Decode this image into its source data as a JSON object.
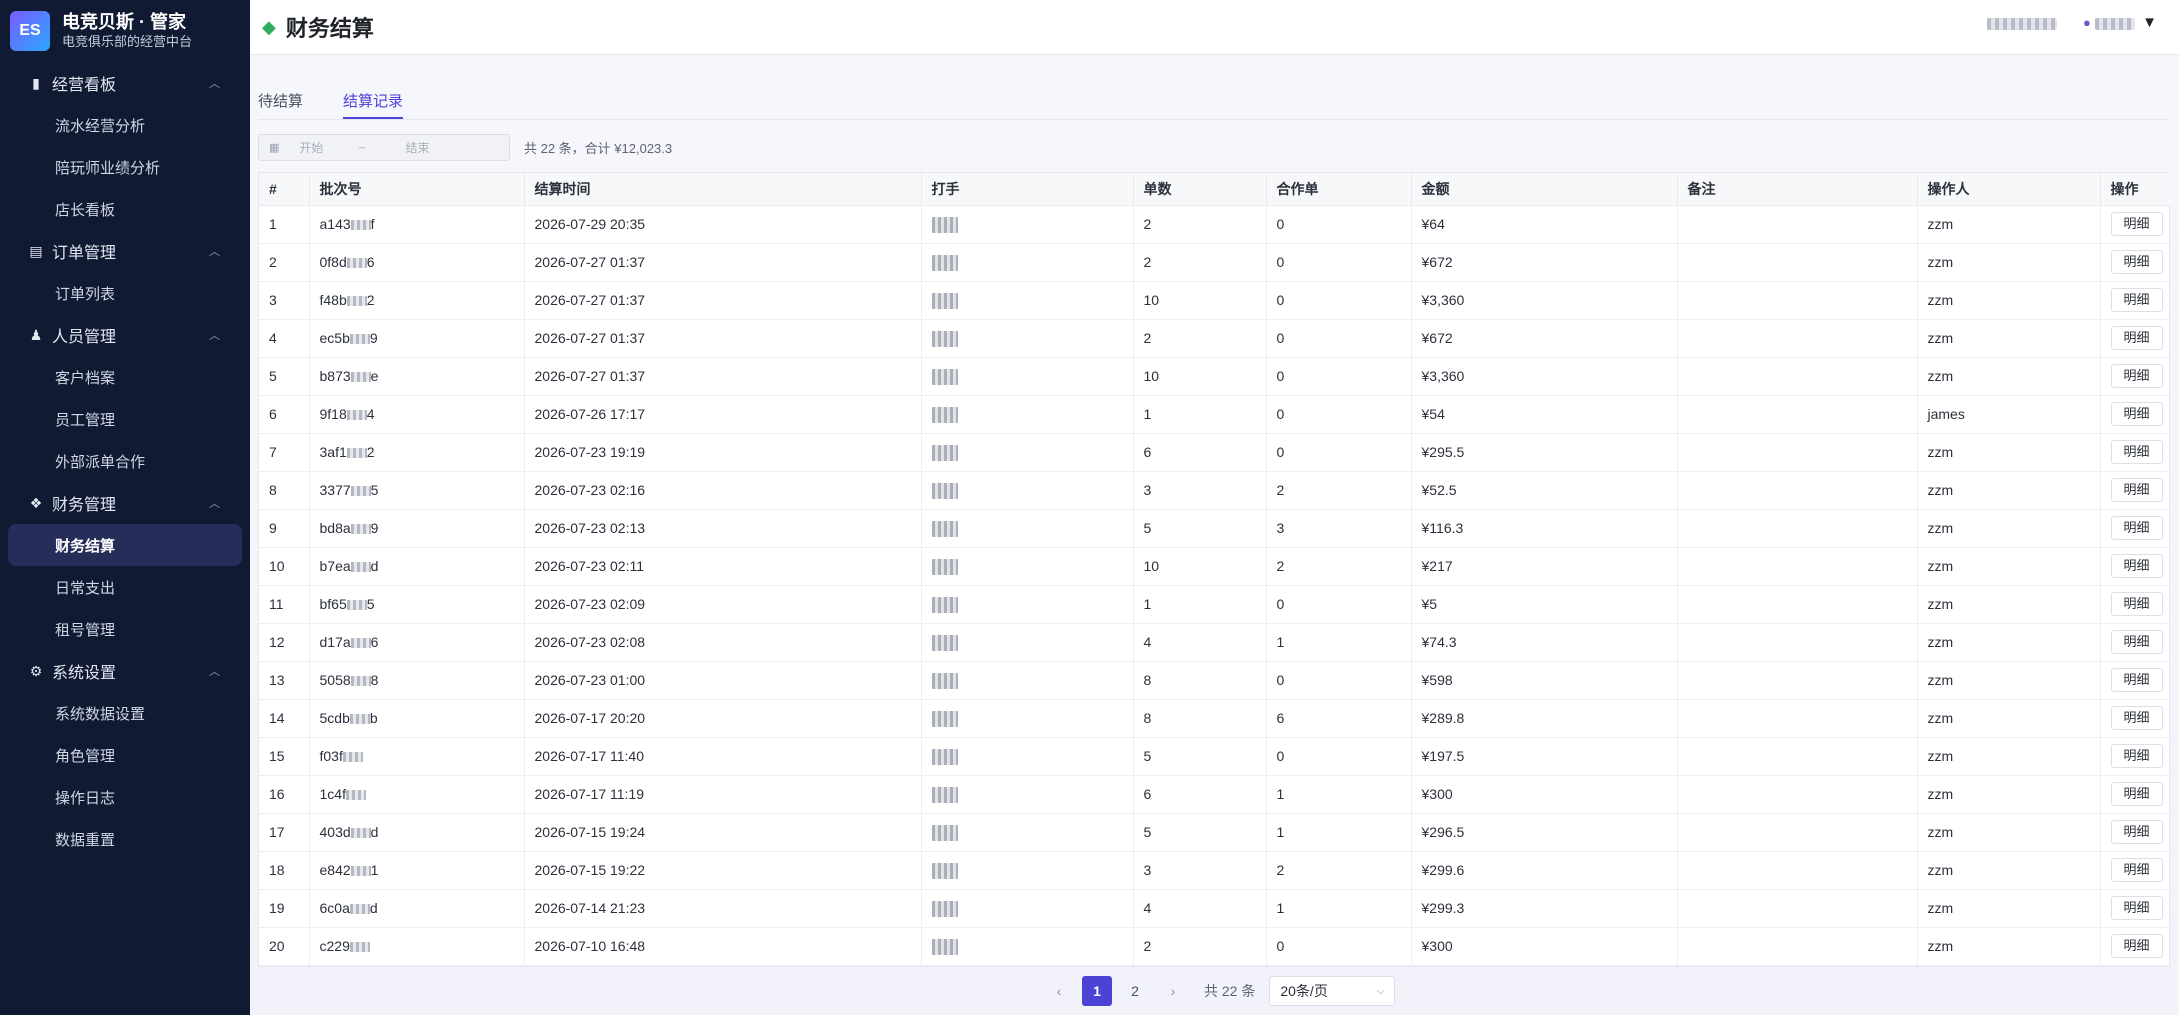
{
  "app": {
    "name": "电竞贝斯 · 管家",
    "subtitle": "电竞俱乐部的经营中台",
    "logo_text": "ES"
  },
  "sidebar": {
    "groups": [
      {
        "icon": "chart-icon",
        "icon_glyph": "▮",
        "label": "经营看板",
        "items": [
          "流水经营分析",
          "陪玩师业绩分析",
          "店长看板"
        ]
      },
      {
        "icon": "clipboard-icon",
        "icon_glyph": "▤",
        "label": "订单管理",
        "items": [
          "订单列表"
        ]
      },
      {
        "icon": "people-icon",
        "icon_glyph": "♟",
        "label": "人员管理",
        "items": [
          "客户档案",
          "员工管理",
          "外部派单合作"
        ]
      },
      {
        "icon": "money-bag-icon",
        "icon_glyph": "❖",
        "label": "财务管理",
        "items": [
          "财务结算",
          "日常支出",
          "租号管理"
        ]
      },
      {
        "icon": "gear-icon",
        "icon_glyph": "⚙",
        "label": "系统设置",
        "items": [
          "系统数据设置",
          "角色管理",
          "操作日志",
          "数据重置"
        ]
      }
    ],
    "active_item": "财务结算"
  },
  "header": {
    "title": "财务结算",
    "title_icon": "cash-icon"
  },
  "tabs": [
    "待结算",
    "结算记录"
  ],
  "active_tab": "结算记录",
  "filter": {
    "start_placeholder": "开始",
    "separator": "~",
    "end_placeholder": "结束",
    "summary": "共 22 条，合计 ¥12,023.3"
  },
  "table": {
    "columns": [
      "#",
      "批次号",
      "结算时间",
      "打手",
      "单数",
      "合作单",
      "金额",
      "备注",
      "操作人",
      "操作"
    ],
    "action_label": "明细",
    "rows": [
      {
        "idx": "1",
        "batch": "a143",
        "batch_tail": "f",
        "time": "2026-07-29 20:35",
        "count": "2",
        "coop": "0",
        "amount": "¥64",
        "note": "",
        "operator": "zzm"
      },
      {
        "idx": "2",
        "batch": "0f8d",
        "batch_tail": "6",
        "time": "2026-07-27 01:37",
        "count": "2",
        "coop": "0",
        "amount": "¥672",
        "note": "",
        "operator": "zzm"
      },
      {
        "idx": "3",
        "batch": "f48b",
        "batch_tail": "2",
        "time": "2026-07-27 01:37",
        "count": "10",
        "coop": "0",
        "amount": "¥3,360",
        "note": "",
        "operator": "zzm"
      },
      {
        "idx": "4",
        "batch": "ec5b",
        "batch_tail": "9",
        "time": "2026-07-27 01:37",
        "count": "2",
        "coop": "0",
        "amount": "¥672",
        "note": "",
        "operator": "zzm"
      },
      {
        "idx": "5",
        "batch": "b873",
        "batch_tail": "e",
        "time": "2026-07-27 01:37",
        "count": "10",
        "coop": "0",
        "amount": "¥3,360",
        "note": "",
        "operator": "zzm"
      },
      {
        "idx": "6",
        "batch": "9f18",
        "batch_tail": "4",
        "time": "2026-07-26 17:17",
        "count": "1",
        "coop": "0",
        "amount": "¥54",
        "note": "",
        "operator": "james"
      },
      {
        "idx": "7",
        "batch": "3af1",
        "batch_tail": "2",
        "time": "2026-07-23 19:19",
        "count": "6",
        "coop": "0",
        "amount": "¥295.5",
        "note": "",
        "operator": "zzm"
      },
      {
        "idx": "8",
        "batch": "3377",
        "batch_tail": "5",
        "time": "2026-07-23 02:16",
        "count": "3",
        "coop": "2",
        "amount": "¥52.5",
        "note": "",
        "operator": "zzm"
      },
      {
        "idx": "9",
        "batch": "bd8a",
        "batch_tail": "9",
        "time": "2026-07-23 02:13",
        "count": "5",
        "coop": "3",
        "amount": "¥116.3",
        "note": "",
        "operator": "zzm"
      },
      {
        "idx": "10",
        "batch": "b7ea",
        "batch_tail": "d",
        "time": "2026-07-23 02:11",
        "count": "10",
        "coop": "2",
        "amount": "¥217",
        "note": "",
        "operator": "zzm"
      },
      {
        "idx": "11",
        "batch": "bf65",
        "batch_tail": "5",
        "time": "2026-07-23 02:09",
        "count": "1",
        "coop": "0",
        "amount": "¥5",
        "note": "",
        "operator": "zzm"
      },
      {
        "idx": "12",
        "batch": "d17a",
        "batch_tail": "6",
        "time": "2026-07-23 02:08",
        "count": "4",
        "coop": "1",
        "amount": "¥74.3",
        "note": "",
        "operator": "zzm"
      },
      {
        "idx": "13",
        "batch": "5058",
        "batch_tail": "8",
        "time": "2026-07-23 01:00",
        "count": "8",
        "coop": "0",
        "amount": "¥598",
        "note": "",
        "operator": "zzm"
      },
      {
        "idx": "14",
        "batch": "5cdb",
        "batch_tail": "b",
        "time": "2026-07-17 20:20",
        "count": "8",
        "coop": "6",
        "amount": "¥289.8",
        "note": "",
        "operator": "zzm"
      },
      {
        "idx": "15",
        "batch": "f03f",
        "batch_tail": "",
        "time": "2026-07-17 11:40",
        "count": "5",
        "coop": "0",
        "amount": "¥197.5",
        "note": "",
        "operator": "zzm"
      },
      {
        "idx": "16",
        "batch": "1c4f",
        "batch_tail": "",
        "time": "2026-07-17 11:19",
        "count": "6",
        "coop": "1",
        "amount": "¥300",
        "note": "",
        "operator": "zzm"
      },
      {
        "idx": "17",
        "batch": "403d",
        "batch_tail": "d",
        "time": "2026-07-15 19:24",
        "count": "5",
        "coop": "1",
        "amount": "¥296.5",
        "note": "",
        "operator": "zzm"
      },
      {
        "idx": "18",
        "batch": "e842",
        "batch_tail": "1",
        "time": "2026-07-15 19:22",
        "count": "3",
        "coop": "2",
        "amount": "¥299.6",
        "note": "",
        "operator": "zzm"
      },
      {
        "idx": "19",
        "batch": "6c0a",
        "batch_tail": "d",
        "time": "2026-07-14 21:23",
        "count": "4",
        "coop": "1",
        "amount": "¥299.3",
        "note": "",
        "operator": "zzm"
      },
      {
        "idx": "20",
        "batch": "c229",
        "batch_tail": "",
        "time": "2026-07-10 16:48",
        "count": "2",
        "coop": "0",
        "amount": "¥300",
        "note": "",
        "operator": "zzm"
      }
    ]
  },
  "pagination": {
    "prev": "‹",
    "pages": [
      "1",
      "2"
    ],
    "current": "1",
    "next": "›",
    "total": "共 22 条",
    "page_size": "20条/页"
  },
  "colors": {
    "sidebar_bg": "#101a33",
    "accent": "#4b42d6",
    "active_item_bg": "#262d59"
  }
}
